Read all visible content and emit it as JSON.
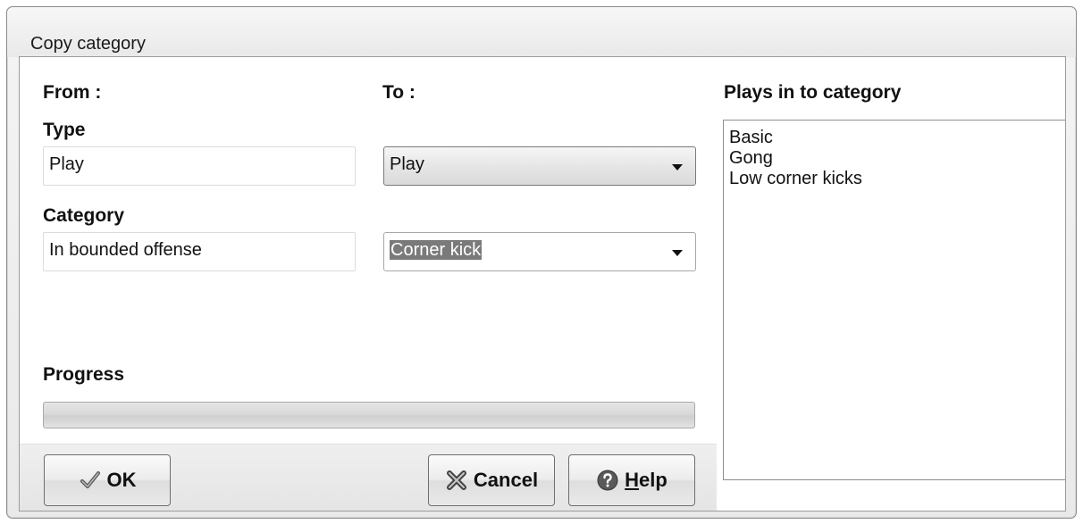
{
  "window": {
    "title": "Copy category"
  },
  "from": {
    "heading": "From :",
    "type_label": "Type",
    "type_value": "Play",
    "category_label": "Category",
    "category_value": "In bounded offense"
  },
  "to": {
    "heading": "To :",
    "type_selected": "Play",
    "category_selected": "Corner kick"
  },
  "progress": {
    "label": "Progress",
    "value_percent": 0
  },
  "plays": {
    "heading": "Plays in to category",
    "items": [
      "Basic",
      "Gong",
      "Low corner kicks"
    ]
  },
  "buttons": {
    "ok": "OK",
    "cancel": "Cancel",
    "help_prefix": "",
    "help_mnemonic": "H",
    "help_rest": "elp"
  },
  "icons": {
    "ok": "checkmark-icon",
    "cancel": "cross-icon",
    "help": "help-icon"
  }
}
